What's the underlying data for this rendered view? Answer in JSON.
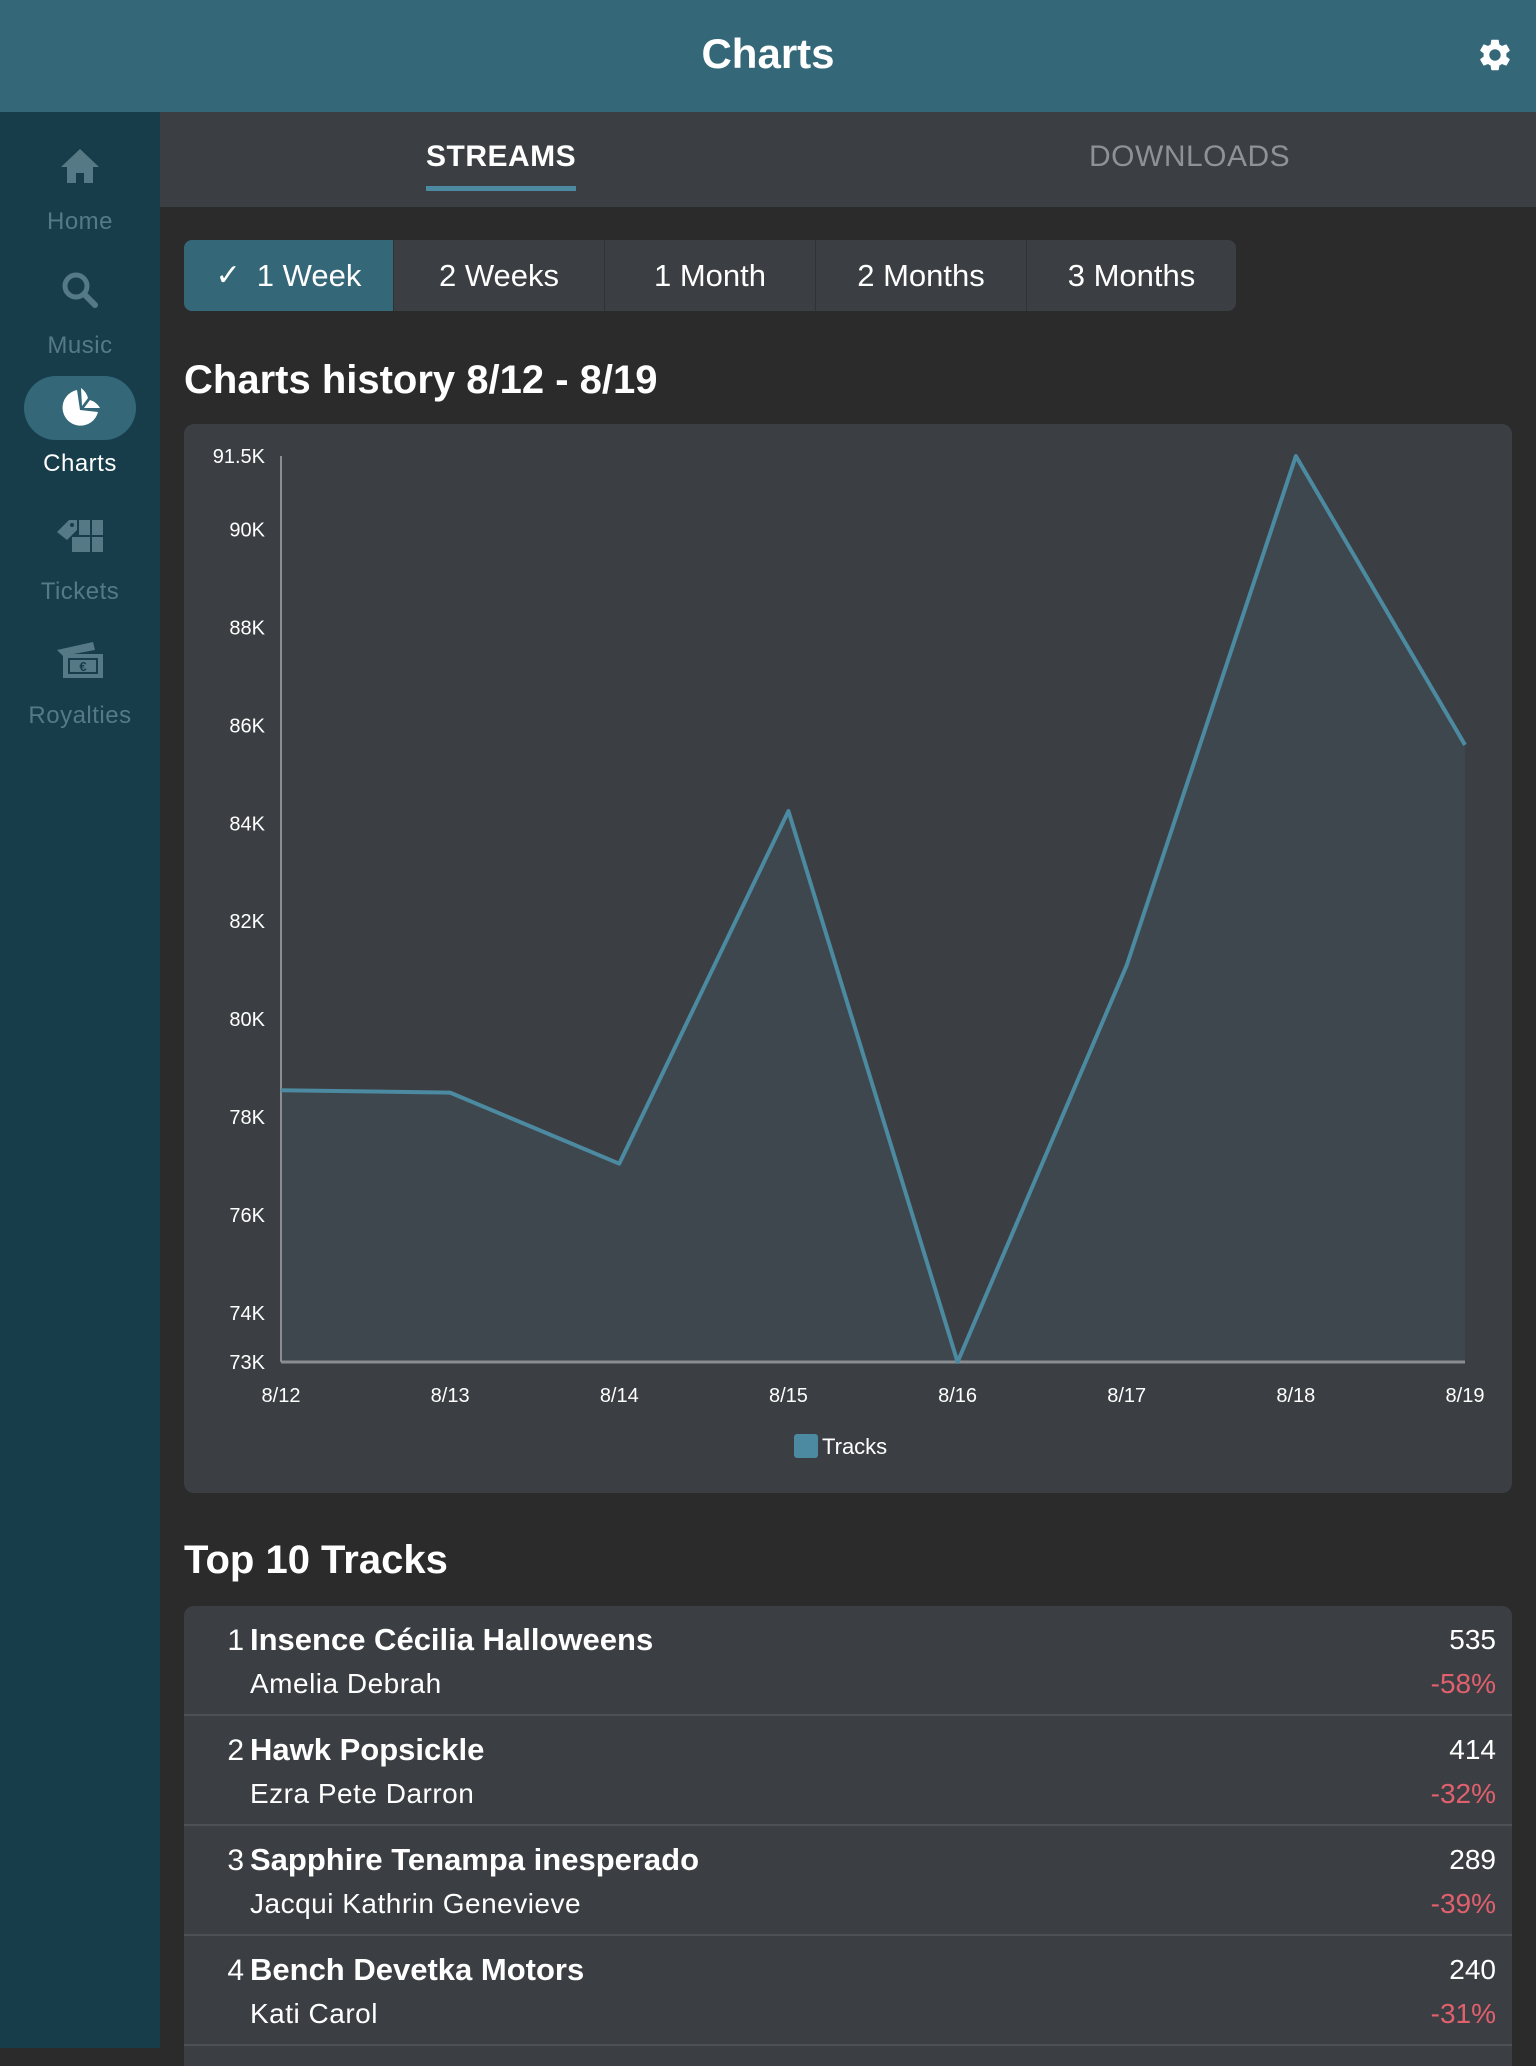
{
  "header": {
    "title": "Charts",
    "settings_icon": "gear-icon"
  },
  "sidebar": {
    "items": [
      {
        "label": "Home",
        "icon": "home-icon",
        "active": false
      },
      {
        "label": "Music",
        "icon": "search-icon",
        "active": false
      },
      {
        "label": "Charts",
        "icon": "pie-chart-icon",
        "active": true
      },
      {
        "label": "Tickets",
        "icon": "ticket-icon",
        "active": false
      },
      {
        "label": "Royalties",
        "icon": "money-icon",
        "active": false
      }
    ]
  },
  "tabs": [
    {
      "label": "STREAMS",
      "active": true
    },
    {
      "label": "DOWNLOADS",
      "active": false
    }
  ],
  "range": {
    "options": [
      "1 Week",
      "2 Weeks",
      "1 Month",
      "2 Months",
      "3 Months"
    ],
    "selected": "1 Week",
    "check_glyph": "✓"
  },
  "chart_section": {
    "title": "Charts history 8/12 - 8/19"
  },
  "chart_data": {
    "type": "area",
    "title": "Charts history 8/12 - 8/19",
    "xlabel": "",
    "ylabel": "",
    "categories": [
      "8/12",
      "8/13",
      "8/14",
      "8/15",
      "8/16",
      "8/17",
      "8/18",
      "8/19"
    ],
    "series": [
      {
        "name": "Tracks",
        "color": "#4b8aa0",
        "values": [
          78550,
          78500,
          77050,
          84250,
          73000,
          81100,
          91500,
          85600
        ]
      }
    ],
    "ylim": [
      73000,
      91500
    ],
    "yticks": [
      {
        "value": 73000,
        "label": "73K"
      },
      {
        "value": 74000,
        "label": "74K"
      },
      {
        "value": 76000,
        "label": "76K"
      },
      {
        "value": 78000,
        "label": "78K"
      },
      {
        "value": 80000,
        "label": "80K"
      },
      {
        "value": 82000,
        "label": "82K"
      },
      {
        "value": 84000,
        "label": "84K"
      },
      {
        "value": 86000,
        "label": "86K"
      },
      {
        "value": 88000,
        "label": "88K"
      },
      {
        "value": 90000,
        "label": "90K"
      },
      {
        "value": 91500,
        "label": "91.5K"
      }
    ],
    "grid": false,
    "legend": "bottom-center"
  },
  "top_tracks": {
    "title": "Top 10 Tracks",
    "items": [
      {
        "rank": "1",
        "title": "Insence Cécilia Halloweens",
        "artist": "Amelia Debrah",
        "count": "535",
        "change": "-58%"
      },
      {
        "rank": "2",
        "title": "Hawk Popsickle",
        "artist": "Ezra Pete Darron",
        "count": "414",
        "change": "-32%"
      },
      {
        "rank": "3",
        "title": "Sapphire Tenampa inesperado",
        "artist": "Jacqui Kathrin Genevieve",
        "count": "289",
        "change": "-39%"
      },
      {
        "rank": "4",
        "title": "Bench Devetka Motors",
        "artist": "Kati Carol",
        "count": "240",
        "change": "-31%"
      }
    ]
  },
  "colors": {
    "header": "#346878",
    "sidebar": "#173d4b",
    "accent": "#4b8aa0",
    "negative": "#e0606e",
    "card": "#3b3e42",
    "background": "#2b2b2b"
  }
}
